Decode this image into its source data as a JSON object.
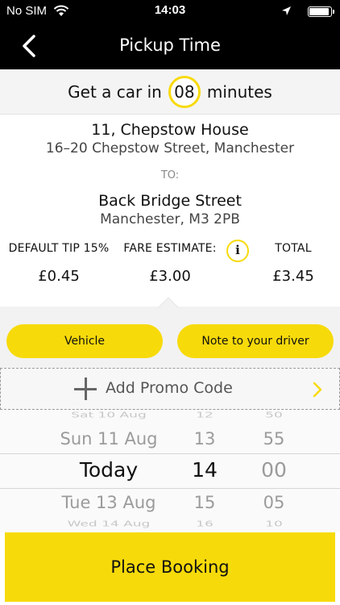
{
  "status_bar": {
    "carrier": "No SIM",
    "time": "14:03"
  },
  "nav": {
    "title": "Pickup Time"
  },
  "eta": {
    "prefix": "Get a car in",
    "minutes": "08",
    "suffix": "minutes"
  },
  "pickup": {
    "line1": "11, Chepstow House",
    "line2": "16–20 Chepstow Street, Manchester"
  },
  "to_label": "TO:",
  "destination": {
    "line1": "Back Bridge Street",
    "line2": "Manchester, M3 2PB"
  },
  "fare": {
    "tip_label": "DEFAULT TIP 15%",
    "tip_value": "£0.45",
    "estimate_label": "FARE ESTIMATE:",
    "estimate_value": "£3.00",
    "total_label": "TOTAL",
    "total_value": "£3.45"
  },
  "buttons": {
    "vehicle": "Vehicle",
    "note": "Note to your driver",
    "promo": "Add Promo Code",
    "place_booking": "Place Booking"
  },
  "picker": {
    "rows": [
      {
        "day": "Sat 10 Aug",
        "hour": "12",
        "minute": "50"
      },
      {
        "day": "Sun 11 Aug",
        "hour": "13",
        "minute": "55"
      },
      {
        "day": "Today",
        "hour": "14",
        "minute": "00"
      },
      {
        "day": "Tue 13 Aug",
        "hour": "15",
        "minute": "05"
      },
      {
        "day": "Wed 14 Aug",
        "hour": "16",
        "minute": "10"
      }
    ]
  },
  "colors": {
    "accent": "#f7da0a",
    "nav_bg": "#000000"
  },
  "icons": [
    "wifi-icon",
    "location-arrow-icon",
    "battery-icon",
    "back-chevron-icon",
    "info-icon",
    "plus-icon",
    "chevron-right-icon"
  ]
}
